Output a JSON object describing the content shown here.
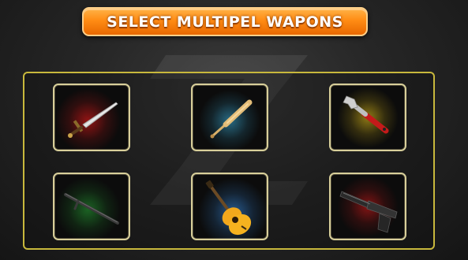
{
  "header": {
    "title": "SELECT MULTIPEL WAPONS"
  },
  "weapons": [
    {
      "icon": "sword-icon",
      "glow": "#ff1a1a"
    },
    {
      "icon": "baseball-bat-icon",
      "glow": "#3fb8e6"
    },
    {
      "icon": "wrench-icon",
      "glow": "#e6c21a"
    },
    {
      "icon": "baton-icon",
      "glow": "#2ecc40"
    },
    {
      "icon": "guitar-icon",
      "glow": "#3a8fe6"
    },
    {
      "icon": "pistol-icon",
      "glow": "#e61a1a"
    }
  ]
}
